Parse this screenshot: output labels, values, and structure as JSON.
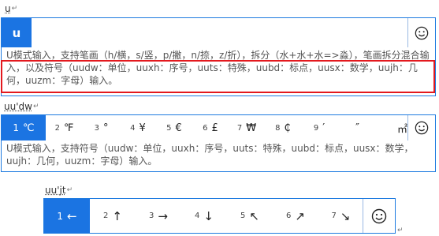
{
  "panel1": {
    "typed": "u",
    "code": "u",
    "description": "U模式输入，支持笔画（h/横，s/竖，p/撇，n/捺，z/折），拆分（水+水+水=>淼），笔画拆分混合输入，以及符号（uudw：单位，uuxh：序号，uuts：特殊，uubd：标点，uusx：数学，uujh：几何，uuzm：字母）输入。",
    "smile_icon": "smile-icon"
  },
  "panel2": {
    "typed": "uu'dw",
    "candidates": [
      {
        "idx": "1",
        "text": "℃"
      },
      {
        "idx": "2",
        "text": "℉"
      },
      {
        "idx": "3",
        "text": "°"
      },
      {
        "idx": "4",
        "text": "¥"
      },
      {
        "idx": "5",
        "text": "€"
      },
      {
        "idx": "6",
        "text": "£"
      },
      {
        "idx": "7",
        "text": "₩"
      },
      {
        "idx": "8",
        "text": "₵"
      },
      {
        "idx": "9",
        "text": "′"
      },
      {
        "idx": "",
        "text": "″"
      },
      {
        "idx": "",
        "text": "㎡"
      }
    ],
    "description": "U模式输入，支持符号（uudw：单位，uuxh：序号，uuts：特殊，uubd：标点，uusx：数学，uujh：几何，uuzm：字母）输入。",
    "smile_icon": "smile-icon"
  },
  "panel3": {
    "typed": "uu'jt",
    "candidates": [
      {
        "idx": "1",
        "text": "←"
      },
      {
        "idx": "2",
        "text": "↑"
      },
      {
        "idx": "3",
        "text": "→"
      },
      {
        "idx": "4",
        "text": "↓"
      },
      {
        "idx": "5",
        "text": "↖"
      },
      {
        "idx": "6",
        "text": "↗"
      },
      {
        "idx": "7",
        "text": "↘"
      }
    ],
    "smile_icon": "smile-icon"
  },
  "return_mark": "↵",
  "colors": {
    "accent": "#1b74e2",
    "highlight": "#e3191e"
  }
}
